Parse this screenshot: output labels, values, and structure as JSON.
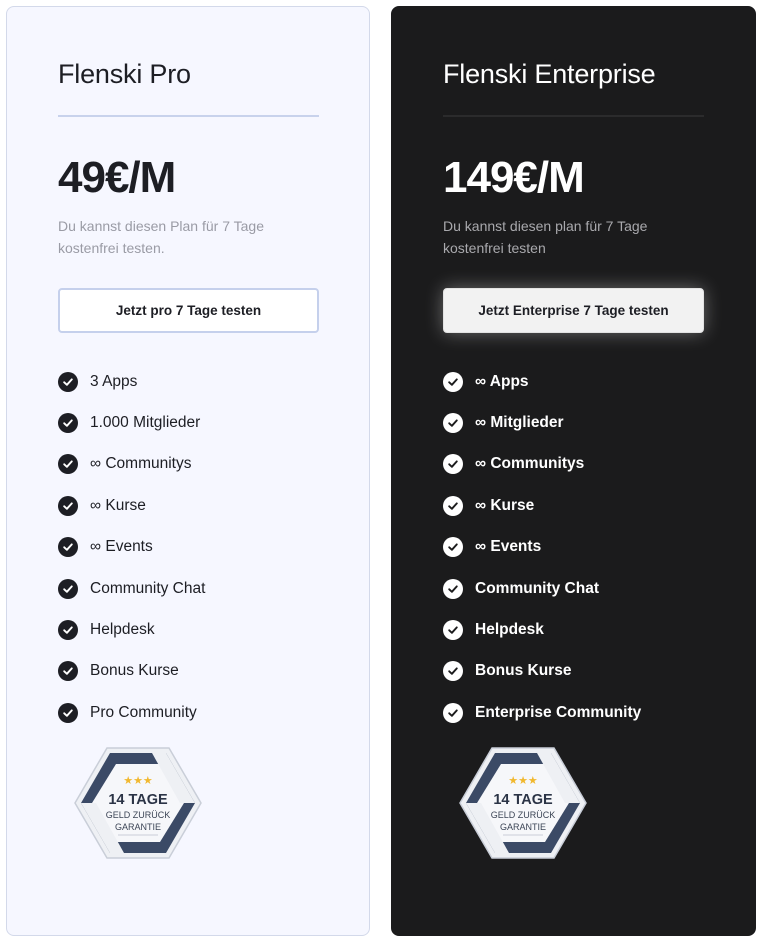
{
  "plans": [
    {
      "name": "Flenski Pro",
      "price": "49€/M",
      "description": "Du kannst diesen Plan für 7 Tage kostenfrei testen.",
      "cta": "Jetzt pro 7 Tage testen",
      "features": [
        "3 Apps",
        "1.000 Mitglieder",
        "∞ Communitys",
        "∞ Kurse",
        "∞ Events",
        "Community Chat",
        "Helpdesk",
        "Bonus Kurse",
        "Pro Community"
      ]
    },
    {
      "name": "Flenski Enterprise",
      "price": "149€/M",
      "description": "Du kannst diesen plan für 7 Tage kostenfrei testen",
      "cta": "Jetzt Enterprise 7 Tage testen",
      "features": [
        "∞ Apps",
        "∞ Mitglieder",
        "∞ Communitys",
        "∞ Kurse",
        "∞ Events",
        "Community Chat",
        "Helpdesk",
        "Bonus Kurse",
        "Enterprise Community"
      ]
    }
  ],
  "badge": {
    "stars": "★★★",
    "days": "14 TAGE",
    "line1": "GELD ZURÜCK",
    "line2": "GARANTIE"
  },
  "colors": {
    "pro_background": "#f6f7ff",
    "enterprise_background": "#1b1b1c",
    "badge_blue": "#3b4a66",
    "star_gold": "#f1b82e"
  },
  "icons": {
    "feature": "check-circle-icon",
    "guarantee": "guarantee-seal-icon"
  }
}
